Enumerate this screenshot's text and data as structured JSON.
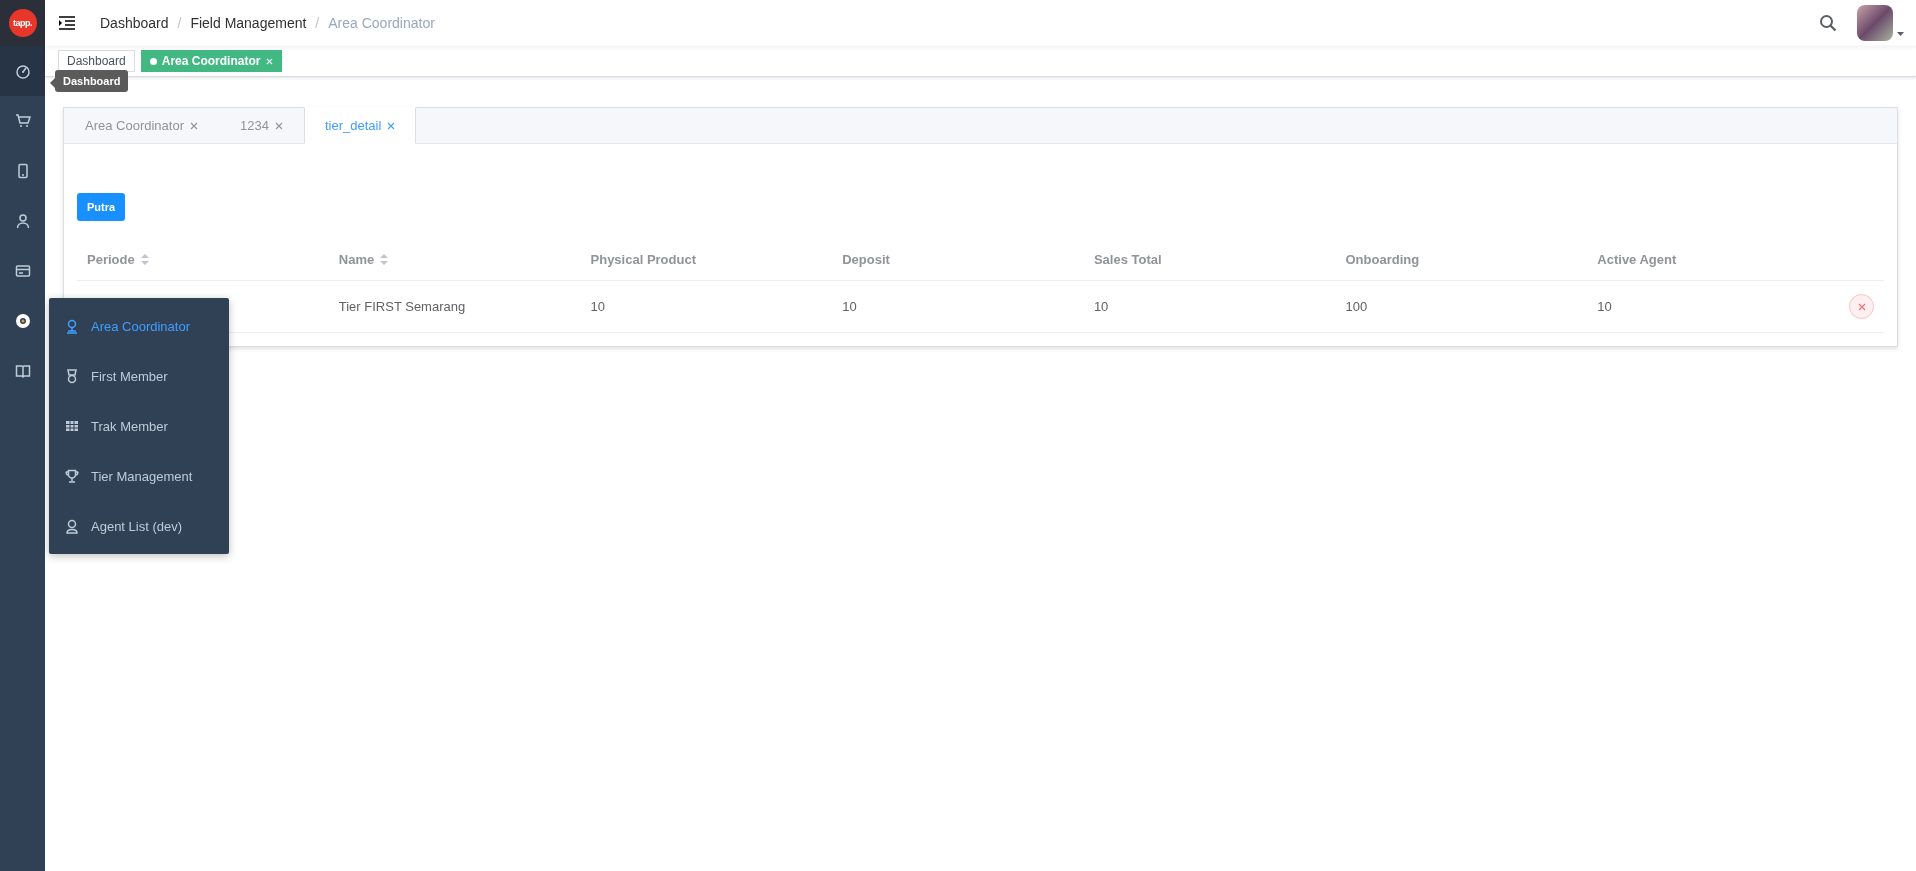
{
  "logo": {
    "text": "tapp."
  },
  "breadcrumb_separators": [
    "/",
    "/"
  ],
  "breadcrumb": [
    {
      "label": "Dashboard",
      "current": false
    },
    {
      "label": "Field Management",
      "current": false
    },
    {
      "label": "Area Coordinator",
      "current": true
    }
  ],
  "tags_view": [
    {
      "label": "Dashboard",
      "selected": false
    },
    {
      "label": "Area Coordinator",
      "selected": true
    }
  ],
  "tooltip": {
    "text": "Dashboard"
  },
  "tabs": [
    {
      "label": "Area Coordinator",
      "selected": false
    },
    {
      "label": "1234",
      "selected": false
    },
    {
      "label": "tier_detail",
      "selected": true
    }
  ],
  "action_button": {
    "label": "Putra"
  },
  "table": {
    "columns": [
      {
        "label": "Periode",
        "sortable": true
      },
      {
        "label": "Name",
        "sortable": true
      },
      {
        "label": "Physical Product",
        "sortable": false
      },
      {
        "label": "Deposit",
        "sortable": false
      },
      {
        "label": "Sales Total",
        "sortable": false
      },
      {
        "label": "Onboarding",
        "sortable": false
      },
      {
        "label": "Active Agent",
        "sortable": false
      }
    ],
    "rows": [
      {
        "cells": [
          "",
          "Tier FIRST Semarang",
          "10",
          "10",
          "10",
          "100",
          "10"
        ]
      }
    ]
  },
  "popup_menu": {
    "items": [
      {
        "label": "Area Coordinator",
        "selected": true
      },
      {
        "label": "First Member",
        "selected": false
      },
      {
        "label": "Trak Member",
        "selected": false
      },
      {
        "label": "Tier Management",
        "selected": false
      },
      {
        "label": "Agent List (dev)",
        "selected": false
      }
    ]
  }
}
